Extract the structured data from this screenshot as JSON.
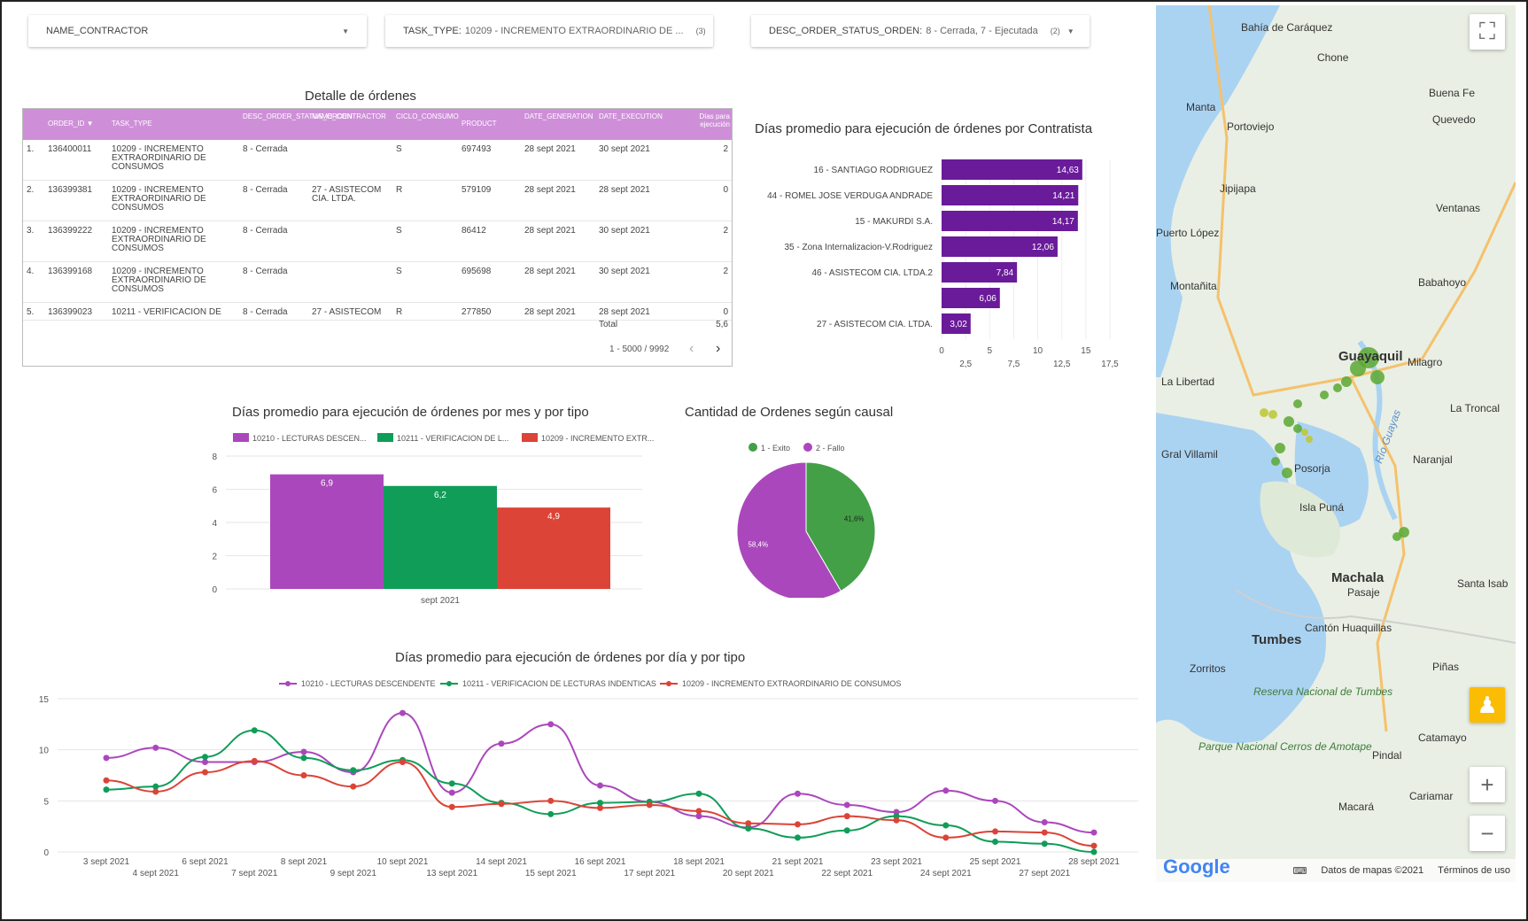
{
  "filters": [
    {
      "label": "NAME_CONTRACTOR",
      "value": "",
      "count": ""
    },
    {
      "label": "TASK_TYPE:",
      "value": "10209 - INCREMENTO EXTRAORDINARIO DE ...",
      "count": "(3)"
    },
    {
      "label": "DESC_ORDER_STATUS_ORDEN:",
      "value": "8 - Cerrada, 7 - Ejecutada",
      "count": "(2)"
    }
  ],
  "orders_table": {
    "title": "Detalle de órdenes",
    "columns": [
      "ORDER_ID",
      "TASK_TYPE",
      "DESC_ORDER_STATUS_ORDEN",
      "NAME_CONTRACTOR",
      "CICLO_CONSUMO",
      "PRODUCT",
      "DATE_GENERATION",
      "DATE_EXECUTION",
      "Días para ejecución"
    ],
    "sort_indicator": "▼",
    "rows": [
      {
        "n": "1.",
        "order_id": "136400011",
        "task_type": "10209 - INCREMENTO EXTRAORDINARIO DE CONSUMOS",
        "status": "8 - Cerrada",
        "contractor": "",
        "ciclo": "S",
        "product": "697493",
        "gen": "28 sept 2021",
        "exe": "30 sept 2021",
        "dias": "2"
      },
      {
        "n": "2.",
        "order_id": "136399381",
        "task_type": "10209 - INCREMENTO EXTRAORDINARIO DE CONSUMOS",
        "status": "8 - Cerrada",
        "contractor": "27 - ASISTECOM CIA. LTDA.",
        "ciclo": "R",
        "product": "579109",
        "gen": "28 sept 2021",
        "exe": "28 sept 2021",
        "dias": "0"
      },
      {
        "n": "3.",
        "order_id": "136399222",
        "task_type": "10209 - INCREMENTO EXTRAORDINARIO DE CONSUMOS",
        "status": "8 - Cerrada",
        "contractor": "",
        "ciclo": "S",
        "product": "86412",
        "gen": "28 sept 2021",
        "exe": "30 sept 2021",
        "dias": "2"
      },
      {
        "n": "4.",
        "order_id": "136399168",
        "task_type": "10209 - INCREMENTO EXTRAORDINARIO DE CONSUMOS",
        "status": "8 - Cerrada",
        "contractor": "",
        "ciclo": "S",
        "product": "695698",
        "gen": "28 sept 2021",
        "exe": "30 sept 2021",
        "dias": "2"
      },
      {
        "n": "5.",
        "order_id": "136399023",
        "task_type": "10211 - VERIFICACION DE",
        "status": "8 - Cerrada",
        "contractor": "27 - ASISTECOM",
        "ciclo": "R",
        "product": "277850",
        "gen": "28 sept 2021",
        "exe": "28 sept 2021",
        "dias": "0"
      }
    ],
    "total_label": "Total",
    "total_value": "5,6",
    "pagination": "1 - 5000 / 9992",
    "prev": "‹",
    "next": "›"
  },
  "chart_data": [
    {
      "type": "bar",
      "orientation": "horizontal",
      "title": "Días promedio para ejecución de órdenes por Contratista",
      "categories": [
        "16 - SANTIAGO RODRIGUEZ",
        "44 - ROMEL JOSE VERDUGA ANDRADE",
        "15 - MAKURDI S.A.",
        "35 - Zona Internalizacion-V.Rodriguez",
        "46 - ASISTECOM CIA. LTDA.2",
        "",
        "27 - ASISTECOM CIA. LTDA."
      ],
      "values": [
        14.63,
        14.21,
        14.17,
        12.06,
        7.84,
        6.06,
        3.02
      ],
      "value_labels": [
        "14,63",
        "14,21",
        "14,17",
        "12,06",
        "7,84",
        "6,06",
        "3,02"
      ],
      "x_ticks_top": [
        "0",
        "5",
        "10",
        "15"
      ],
      "x_ticks_bottom": [
        "2,5",
        "7,5",
        "12,5",
        "17,5"
      ],
      "xlim": [
        0,
        17.5
      ],
      "color": "#6a1b9a"
    },
    {
      "type": "bar",
      "title": "Días promedio para ejecución de órdenes por mes y por tipo",
      "categories": [
        "sept 2021"
      ],
      "series": [
        {
          "name": "10210 - LECTURAS DESCEN...",
          "values": [
            6.9
          ],
          "label": "6,9",
          "color": "#ab47bc"
        },
        {
          "name": "10211 - VERIFICACION DE L...",
          "values": [
            6.2
          ],
          "label": "6,2",
          "color": "#0f9d58"
        },
        {
          "name": "10209 - INCREMENTO EXTR...",
          "values": [
            4.9
          ],
          "label": "4,9",
          "color": "#db4437"
        }
      ],
      "y_ticks": [
        "0",
        "2",
        "4",
        "6",
        "8"
      ],
      "ylim": [
        0,
        8
      ]
    },
    {
      "type": "pie",
      "title": "Cantidad de Ordenes según causal",
      "labels": [
        "1 - Exito",
        "2 - Fallo"
      ],
      "values": [
        41.6,
        58.4
      ],
      "value_labels": [
        "41,6%",
        "58,4%"
      ],
      "colors": [
        "#43a047",
        "#ab47bc"
      ]
    },
    {
      "type": "line",
      "title": "Días promedio para ejecución de órdenes por día y por tipo",
      "x": [
        "3 sept 2021",
        "4 sept 2021",
        "6 sept 2021",
        "7 sept 2021",
        "8 sept 2021",
        "9 sept 2021",
        "10 sept 2021",
        "13 sept 2021",
        "14 sept 2021",
        "15 sept 2021",
        "16 sept 2021",
        "17 sept 2021",
        "18 sept 2021",
        "20 sept 2021",
        "21 sept 2021",
        "22 sept 2021",
        "23 sept 2021",
        "24 sept 2021",
        "25 sept 2021",
        "27 sept 2021",
        "28 sept 2021"
      ],
      "series": [
        {
          "name": "10210 - LECTURAS DESCENDENTE",
          "color": "#ab47bc",
          "values": [
            9.2,
            10.2,
            8.8,
            8.8,
            9.8,
            7.8,
            13.6,
            5.8,
            10.6,
            12.5,
            6.5,
            4.9,
            3.5,
            2.4,
            5.7,
            4.6,
            3.9,
            6.0,
            5.0,
            2.9,
            1.9
          ]
        },
        {
          "name": "10211 - VERIFICACION DE LECTURAS INDENTICAS",
          "color": "#0f9d58",
          "values": [
            6.1,
            6.4,
            9.3,
            11.9,
            9.2,
            8.0,
            9.0,
            6.7,
            4.8,
            3.7,
            4.8,
            4.9,
            5.7,
            2.3,
            1.4,
            2.1,
            3.5,
            2.6,
            1.0,
            0.8,
            0.0
          ]
        },
        {
          "name": "10209 - INCREMENTO EXTRAORDINARIO DE CONSUMOS",
          "color": "#db4437",
          "values": [
            7.0,
            5.9,
            7.8,
            8.9,
            7.5,
            6.4,
            8.8,
            4.4,
            4.7,
            5.0,
            4.3,
            4.6,
            4.0,
            2.8,
            2.7,
            3.5,
            3.1,
            1.4,
            2.0,
            1.9,
            0.6
          ]
        }
      ],
      "y_ticks": [
        "0",
        "5",
        "10",
        "15"
      ],
      "ylim": [
        0,
        15
      ]
    }
  ],
  "map": {
    "places": [
      {
        "name": "Bahía de Caráquez"
      },
      {
        "name": "Chone"
      },
      {
        "name": "Manta"
      },
      {
        "name": "Portoviejo"
      },
      {
        "name": "Buena Fe"
      },
      {
        "name": "Quevedo"
      },
      {
        "name": "Jipijapa"
      },
      {
        "name": "Ventanas"
      },
      {
        "name": "Puerto López"
      },
      {
        "name": "Montañita"
      },
      {
        "name": "Babahoyo"
      },
      {
        "name": "La Libertad"
      },
      {
        "name": "Guayaquil"
      },
      {
        "name": "Milagro"
      },
      {
        "name": "La Troncal"
      },
      {
        "name": "Gral Villamil"
      },
      {
        "name": "Posorja"
      },
      {
        "name": "Naranjal"
      },
      {
        "name": "Isla Puná"
      },
      {
        "name": "Machala"
      },
      {
        "name": "Pasaje"
      },
      {
        "name": "Santa Isab"
      },
      {
        "name": "Tumbes"
      },
      {
        "name": "Cantón Huaquillas"
      },
      {
        "name": "Zorritos"
      },
      {
        "name": "Piñas"
      },
      {
        "name": "Reserva Nacional de Tumbes"
      },
      {
        "name": "Catamayo"
      },
      {
        "name": "Pindal"
      },
      {
        "name": "Parque Nacional Cerros de Amotape"
      },
      {
        "name": "Macará"
      },
      {
        "name": "Cariamar"
      },
      {
        "name": "Río Guayas"
      }
    ],
    "attribution": "Datos de mapas ©2021",
    "terms": "Términos de uso",
    "google": "Google"
  }
}
